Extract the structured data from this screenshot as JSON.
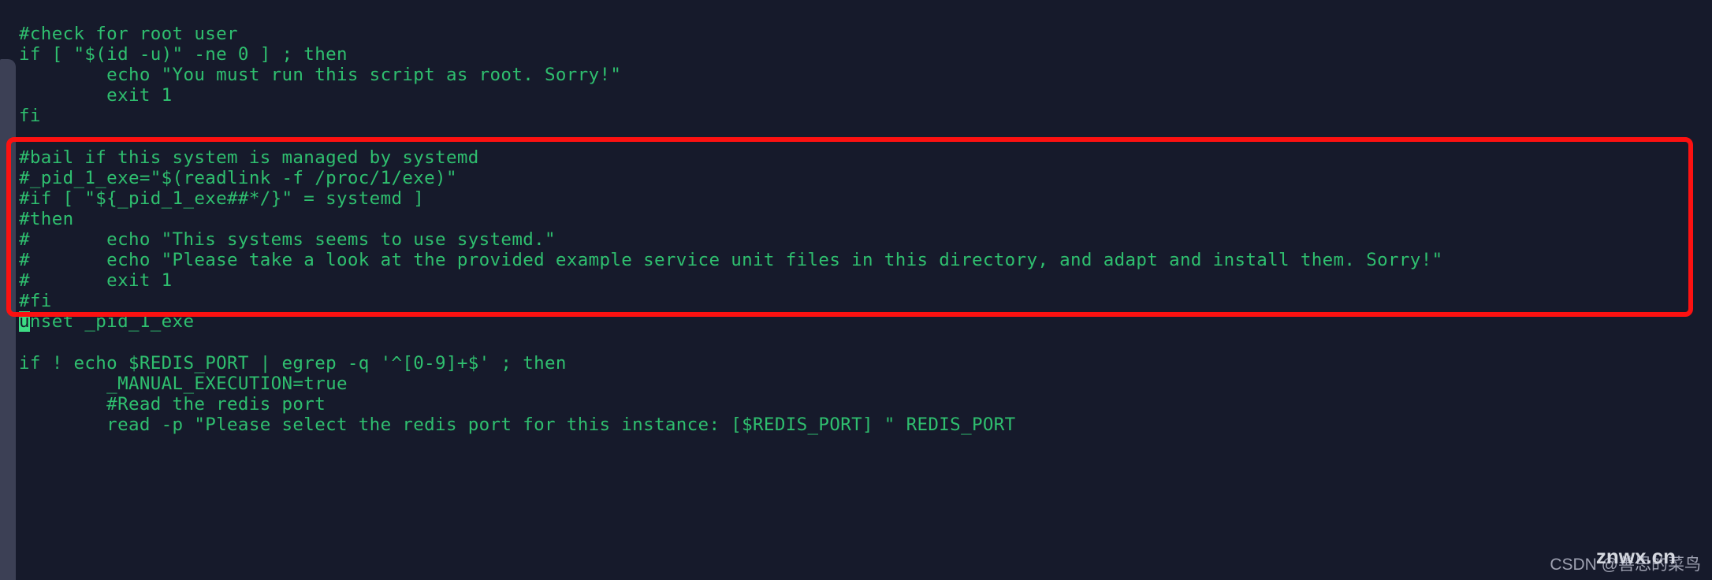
{
  "editor": {
    "background_color": "#161a2b",
    "code_color": "#2fbf6f",
    "cursor_color": "#3ddc84",
    "annotation_color": "#fc1111",
    "scrollbar_color": "#3c4055",
    "lines": [
      {
        "text": "#check for root user"
      },
      {
        "text": "if [ \"$(id -u)\" -ne 0 ] ; then"
      },
      {
        "text": "        echo \"You must run this script as root. Sorry!\""
      },
      {
        "text": "        exit 1"
      },
      {
        "text": "fi"
      },
      {
        "text": ""
      },
      {
        "text": "#bail if this system is managed by systemd"
      },
      {
        "text": "#_pid_1_exe=\"$(readlink -f /proc/1/exe)\""
      },
      {
        "text": "#if [ \"${_pid_1_exe##*/}\" = systemd ]"
      },
      {
        "text": "#then"
      },
      {
        "text": "#       echo \"This systems seems to use systemd.\""
      },
      {
        "text": "#       echo \"Please take a look at the provided example service unit files in this directory, and adapt and install them. Sorry!\""
      },
      {
        "text": "#       exit 1"
      },
      {
        "text": "#fi"
      },
      {
        "text": "unset _pid_1_exe",
        "cursor_index": 0
      },
      {
        "text": ""
      },
      {
        "text": "if ! echo $REDIS_PORT | egrep -q '^[0-9]+$' ; then"
      },
      {
        "text": "        _MANUAL_EXECUTION=true"
      },
      {
        "text": "        #Read the redis port"
      },
      {
        "text": "        read -p \"Please select the redis port for this instance: [$REDIS_PORT] \" REDIS_PORT"
      }
    ]
  },
  "annotation": {
    "label": "red-highlight-rectangle",
    "covers_lines": "#bail if this system is managed by systemd through #fi"
  },
  "watermarks": {
    "csdn": "CSDN @善思的菜鸟",
    "site": "znwx.cn"
  }
}
